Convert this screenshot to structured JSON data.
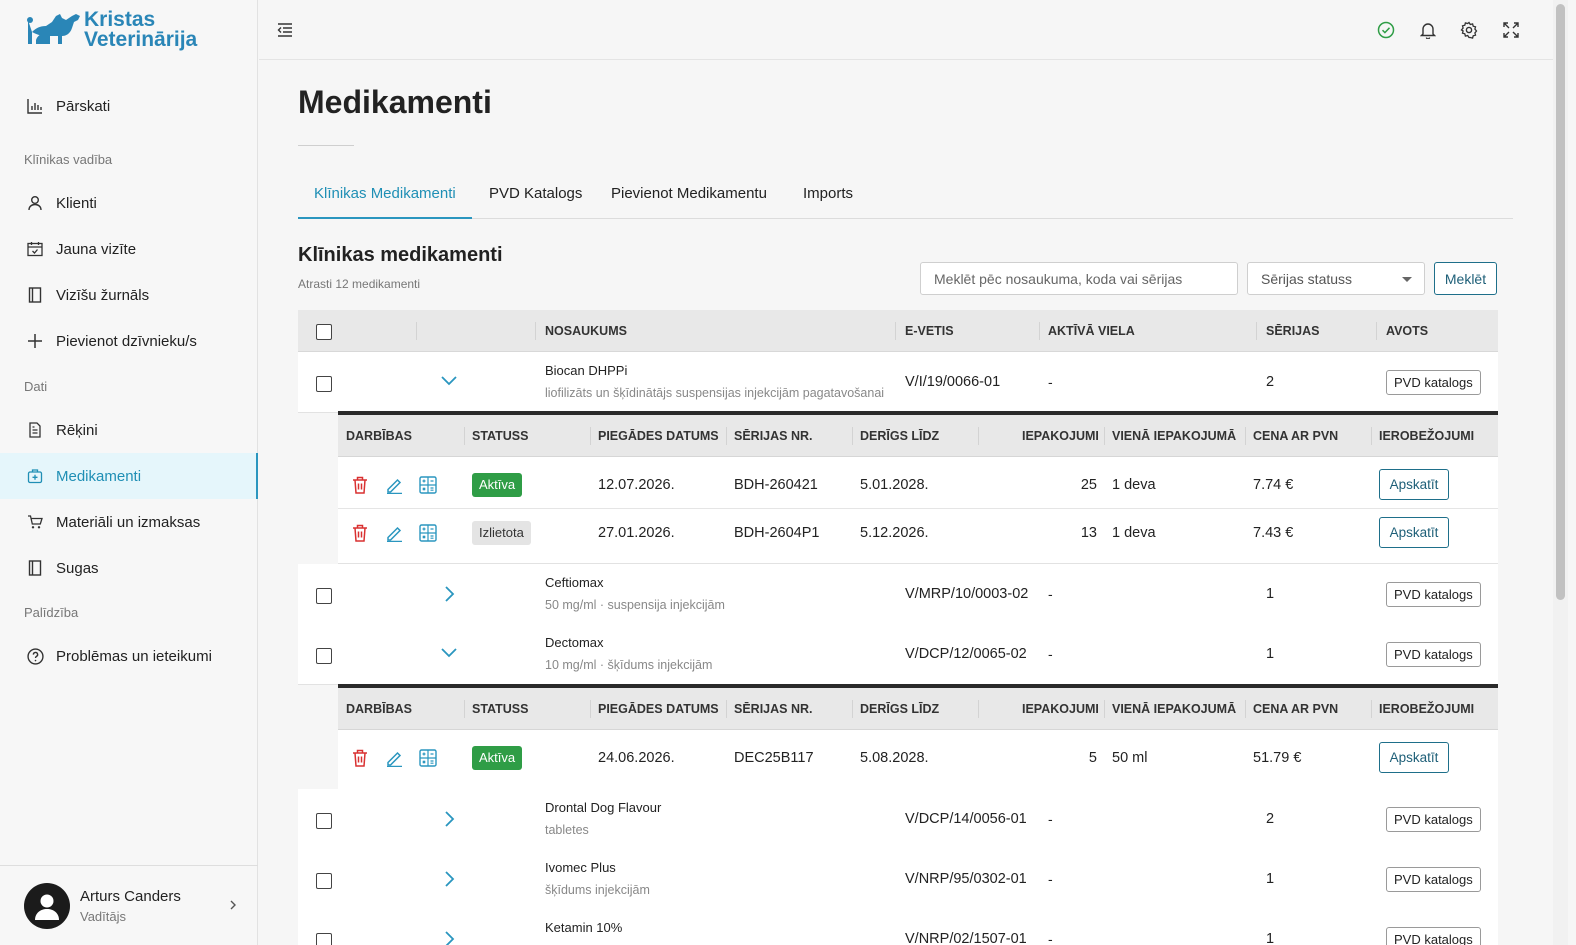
{
  "brand": {
    "line1": "Kristas",
    "line2": "Veterinārija",
    "color": "#2a86b7"
  },
  "sidebar": {
    "top_item": {
      "label": "Pārskati",
      "icon": "bar-chart-icon"
    },
    "sections": [
      {
        "title": "Klīnikas vadība"
      },
      {
        "title": "Dati"
      },
      {
        "title": "Palīdzība"
      }
    ],
    "items": [
      {
        "label": "Klienti",
        "icon": "user-icon"
      },
      {
        "label": "Jauna vizīte",
        "icon": "calendar-check-icon"
      },
      {
        "label": "Vizīšu žurnāls",
        "icon": "book-icon"
      },
      {
        "label": "Pievienot dzīvnieku/s",
        "icon": "plus-icon"
      },
      {
        "label": "Rēķini",
        "icon": "invoice-icon"
      },
      {
        "label": "Medikamenti",
        "icon": "medkit-icon",
        "active": true
      },
      {
        "label": "Materiāli un izmaksas",
        "icon": "cart-icon"
      },
      {
        "label": "Sugas",
        "icon": "book-icon"
      },
      {
        "label": "Problēmas un ieteikumi",
        "icon": "help-circle-icon"
      }
    ],
    "user": {
      "name": "Arturs Canders",
      "role": "Vadītājs"
    }
  },
  "topbar": {
    "icons": [
      "menu-collapse-icon",
      "check-circle-icon",
      "bell-icon",
      "gear-icon",
      "fullscreen-icon"
    ]
  },
  "page": {
    "title": "Medikamenti",
    "tabs": [
      "Klīnikas Medikamenti",
      "PVD Katalogs",
      "Pievienot Medikamentu",
      "Imports"
    ],
    "section_title": "Klīnikas medikamenti",
    "found_text": "Atrasti 12 medikamenti",
    "search_placeholder": "Meklēt pēc nosaukuma, koda vai sērijas",
    "status_select": "Sērijas statuss",
    "search_button": "Meklēt"
  },
  "table": {
    "headers": {
      "name": "Nosaukums",
      "evetis": "E-vetis",
      "active": "Aktīvā viela",
      "series": "Sērijas",
      "source": "Avots"
    },
    "rows": [
      {
        "name": "Biocan DHPPi",
        "desc": "liofilizāts un šķīdinātājs suspensijas injekcijām pagatavošanai",
        "code": "V/I/19/0066-01",
        "active": "-",
        "series": "2",
        "source": "PVD katalogs",
        "expanded": true
      },
      {
        "name": "Ceftiomax",
        "desc": "50 mg/ml · suspensija injekcijām",
        "code": "V/MRP/10/0003-02",
        "active": "-",
        "series": "1",
        "source": "PVD katalogs",
        "expanded": false
      },
      {
        "name": "Dectomax",
        "desc": "10 mg/ml · šķīdums injekcijām",
        "code": "V/DCP/12/0065-02",
        "active": "-",
        "series": "1",
        "source": "PVD katalogs",
        "expanded": true
      },
      {
        "name": "Drontal Dog Flavour",
        "desc": "tabletes",
        "code": "V/DCP/14/0056-01",
        "active": "-",
        "series": "2",
        "source": "PVD katalogs",
        "expanded": false
      },
      {
        "name": "Ivomec Plus",
        "desc": "šķīdums injekcijām",
        "code": "V/NRP/95/0302-01",
        "active": "-",
        "series": "1",
        "source": "PVD katalogs",
        "expanded": false
      },
      {
        "name": "Ketamin 10%",
        "desc": "",
        "code": "V/NRP/02/1507-01",
        "active": "-",
        "series": "1",
        "source": "PVD katalogs",
        "expanded": false
      }
    ]
  },
  "batch_table": {
    "headers": {
      "actions": "Darbības",
      "status": "Statuss",
      "delivery": "Piegādes datums",
      "serial": "Sērijas nr.",
      "valid": "Derīgs līdz",
      "packs": "Iepakojumi",
      "per_pack": "Vienā iepakojumā",
      "price": "Cena ar PVN",
      "limits": "Ierobežojumi"
    },
    "view_button": "Apskatīt",
    "groups": [
      {
        "rows": [
          {
            "status": "Aktīva",
            "status_color": "#2f9d46",
            "delivery": "12.07.2026.",
            "serial": "BDH-260421",
            "valid": "5.01.2028.",
            "packs": "25",
            "per_pack": "1 deva",
            "price": "7.74 €"
          },
          {
            "status": "Izlietota",
            "status_color": "#e4e4e4",
            "delivery": "27.01.2026.",
            "serial": "BDH-2604P1",
            "valid": "5.12.2026.",
            "packs": "13",
            "per_pack": "1 deva",
            "price": "7.43 €"
          }
        ]
      },
      {
        "rows": [
          {
            "status": "Aktīva",
            "status_color": "#2f9d46",
            "delivery": "24.06.2026.",
            "serial": "DEC25B117",
            "valid": "5.08.2028.",
            "packs": "5",
            "per_pack": "50 ml",
            "price": "51.79 €"
          }
        ]
      }
    ]
  }
}
